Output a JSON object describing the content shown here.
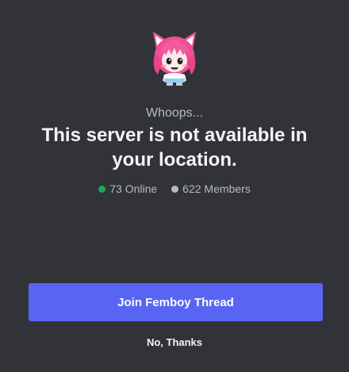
{
  "colors": {
    "background": "#313338",
    "primary_button": "#5865f2",
    "online_dot": "#23a55a",
    "members_dot": "#b5bac1",
    "muted_text": "#b5bac1",
    "heading_text": "#f2f3f5"
  },
  "avatar": {
    "icon": "pink-haired-cat-girl-avatar-icon"
  },
  "modal": {
    "eyebrow": "Whoops...",
    "title": "This server is not available in your location."
  },
  "stats": {
    "online_label": "73 Online",
    "members_label": "622 Members"
  },
  "actions": {
    "join_label": "Join Femboy Thread",
    "dismiss_label": "No, Thanks"
  }
}
